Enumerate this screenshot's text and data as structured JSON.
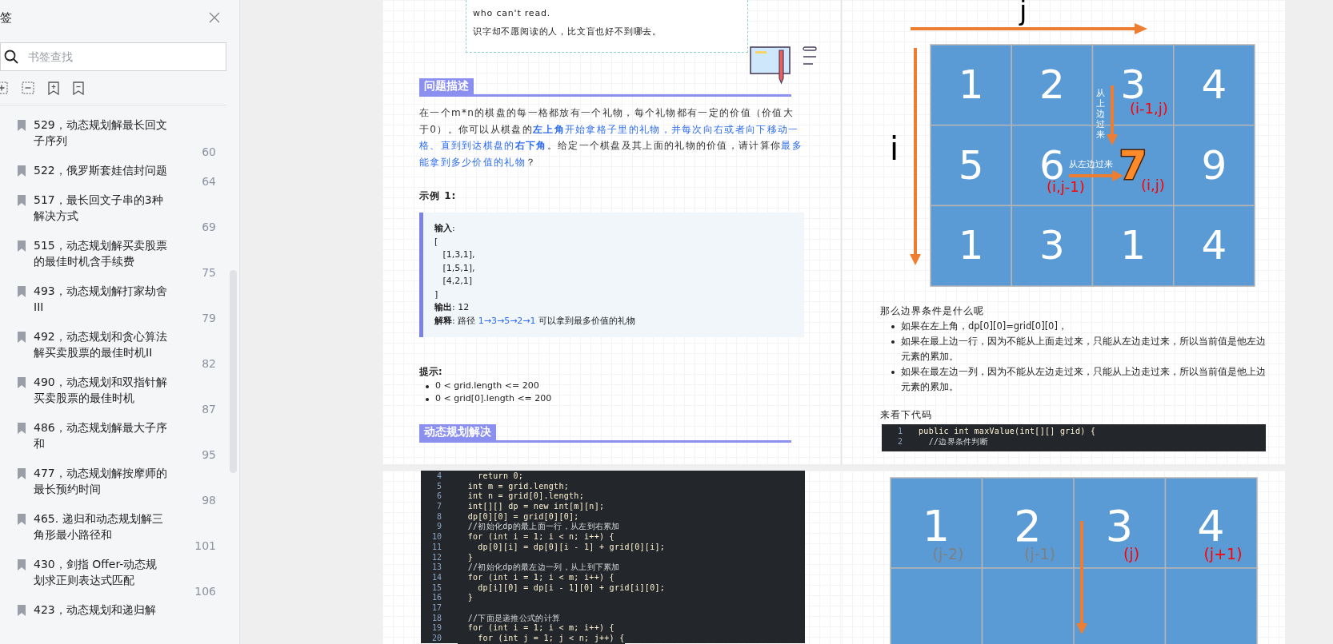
{
  "sidebar": {
    "title": "签",
    "search": {
      "placeholder": "书签查找"
    },
    "bookmarks": [
      {
        "title": "529，动态规划解最长回文子序列",
        "page": "60"
      },
      {
        "title": "522，俄罗斯套娃信封问题",
        "page": "64"
      },
      {
        "title": "517，最长回文子串的3种解决方式",
        "page": "69"
      },
      {
        "title": "515，动态规划解买卖股票的最佳时机含手续费",
        "page": "75"
      },
      {
        "title": "493，动态规划解打家劫舍III",
        "page": "79"
      },
      {
        "title": "492，动态规划和贪心算法解买卖股票的最佳时机II",
        "page": "82"
      },
      {
        "title": "490，动态规划和双指针解买卖股票的最佳时机",
        "page": "87"
      },
      {
        "title": "486，动态规划解最大子序和",
        "page": "95"
      },
      {
        "title": "477，动态规划解按摩师的最长预约时间",
        "page": "98"
      },
      {
        "title": "465. 递归和动态规划解三角形最小路径和",
        "page": "101"
      },
      {
        "title": "430，剑指 Offer-动态规划求正则表达式匹配",
        "page": "106"
      },
      {
        "title": "423，动态规划和递归解"
      }
    ]
  },
  "page_1": {
    "quote": [
      "who can't read.",
      "识字却不愿阅读的人，比文盲也好不到哪去。"
    ],
    "section_title": "问题描述",
    "description": [
      {
        "text": "在一个m*n的棋盘的每一格都放有一个礼物，每个礼物都有一定的价值（价值大于0）。你可以从棋盘的",
        "highlight": false
      },
      {
        "text": "**左上角**开始拿格子里的礼物，并每次向右或者向下移动一格、直到到达棋盘的**右下角**",
        "highlight": true
      },
      {
        "text": "。给定一个棋盘及其上面的礼物的价值，请计算你",
        "highlight": false
      },
      {
        "text": "最多能拿到多少价值的礼物",
        "highlight": true
      },
      {
        "text": "？",
        "highlight": false
      }
    ],
    "example_title": "示例 1:",
    "example_lines": [
      [
        {
          "text": "**输入**:",
          "highlight": false
        }
      ],
      [
        {
          "text": "[",
          "highlight": false
        }
      ],
      [
        {
          "text": "   [1,3,1],",
          "highlight": false
        }
      ],
      [
        {
          "text": "   [1,5,1],",
          "highlight": false
        }
      ],
      [
        {
          "text": "   [4,2,1]",
          "highlight": false
        }
      ],
      [
        {
          "text": "]",
          "highlight": false
        }
      ],
      [
        {
          "text": "**输出**: 12",
          "highlight": false
        }
      ],
      [
        {
          "text": "**解释**: 路径 ",
          "highlight": false
        },
        {
          "text": "1→3→5→2→1",
          "highlight": true
        },
        {
          "text": " 可以拿到最多价值的礼物",
          "highlight": false
        }
      ]
    ],
    "hints_title": "提示:",
    "hints": [
      "0 < grid.length <= 200",
      "0 < grid[0].length <= 200"
    ],
    "section_title_2": "动态规划解决"
  },
  "page_2": {
    "diagram": {
      "col_axis": "j",
      "row_axis": "i",
      "rows": [
        [
          {
            "text": "1",
            "highlight": false
          },
          {
            "text": "2",
            "highlight": false
          },
          {
            "text": "3",
            "highlight": false
          },
          {
            "text": "4",
            "highlight": false
          }
        ],
        [
          {
            "text": "5",
            "highlight": false
          },
          {
            "text": "6",
            "highlight": false
          },
          {
            "text": "7",
            "highlight": true
          },
          {
            "text": "9",
            "highlight": false
          }
        ],
        [
          {
            "text": "1",
            "highlight": false
          },
          {
            "text": "3",
            "highlight": false
          },
          {
            "text": "1",
            "highlight": false
          },
          {
            "text": "4",
            "highlight": false
          }
        ]
      ],
      "from_top": "从上边过来",
      "from_left": "从左边过来",
      "top_label": "(i-1,j)",
      "left_label": "(i,j-1)",
      "current_label": "(i,j)"
    },
    "question": "那么边界条件是什么呢",
    "bullets": [
      "如果在左上角，dp[0][0]=grid[0][0]，",
      "如果在最上边一行，因为不能从上面走过来，只能从左边走过来，所以当前值是他左边元素的累加。",
      "如果在最左边一列，因为不能从左边走过来，只能从上边走过来，所以当前值是他上边元素的累加。"
    ],
    "code_intro": "来看下代码",
    "code": [
      {
        "no": "1",
        "text": "public int maxValue(int[][] grid) {",
        "kind": "code"
      },
      {
        "no": "2",
        "text": "  //边界条件判断",
        "kind": "comment"
      }
    ]
  },
  "page_3": {
    "code": [
      {
        "no": "4",
        "text": "    return 0;",
        "kind": "code"
      },
      {
        "no": "5",
        "text": "  int m = grid.length;",
        "kind": "code"
      },
      {
        "no": "6",
        "text": "  int n = grid[0].length;",
        "kind": "code"
      },
      {
        "no": "7",
        "text": "  int[][] dp = new int[m][n];",
        "kind": "code"
      },
      {
        "no": "8",
        "text": "  dp[0][0] = grid[0][0];",
        "kind": "code"
      },
      {
        "no": "9",
        "text": "  //初始化dp的最上面一行，从左到右累加",
        "kind": "comment"
      },
      {
        "no": "10",
        "text": "  for (int i = 1; i < n; i++) {",
        "kind": "code"
      },
      {
        "no": "11",
        "text": "    dp[0][i] = dp[0][i - 1] + grid[0][i];",
        "kind": "code"
      },
      {
        "no": "12",
        "text": "  }",
        "kind": "code"
      },
      {
        "no": "13",
        "text": "  //初始化dp的最左边一列，从上到下累加",
        "kind": "comment"
      },
      {
        "no": "14",
        "text": "  for (int i = 1; i < m; i++) {",
        "kind": "code"
      },
      {
        "no": "15",
        "text": "    dp[i][0] = dp[i - 1][0] + grid[i][0];",
        "kind": "code"
      },
      {
        "no": "16",
        "text": "  }",
        "kind": "code"
      },
      {
        "no": "17",
        "kind": "blank"
      },
      {
        "no": "18",
        "text": "  //下面是递推公式的计算",
        "kind": "comment"
      },
      {
        "no": "19",
        "text": "  for (int i = 1; i < m; i++) {",
        "kind": "code"
      },
      {
        "no": "20",
        "text": "    for (int j = 1; j < n; j++) {",
        "kind": "code"
      }
    ]
  },
  "page_4": {
    "cells": [
      "1",
      "2",
      "3",
      "4"
    ],
    "labels": [
      {
        "text": "(j-2)",
        "color": "#7f7f7f"
      },
      {
        "text": "(j-1)",
        "color": "#7f7f7f"
      },
      {
        "text": "(j)",
        "color": "#ff0000"
      },
      {
        "text": "(j+1)",
        "color": "#ff0000"
      }
    ]
  }
}
